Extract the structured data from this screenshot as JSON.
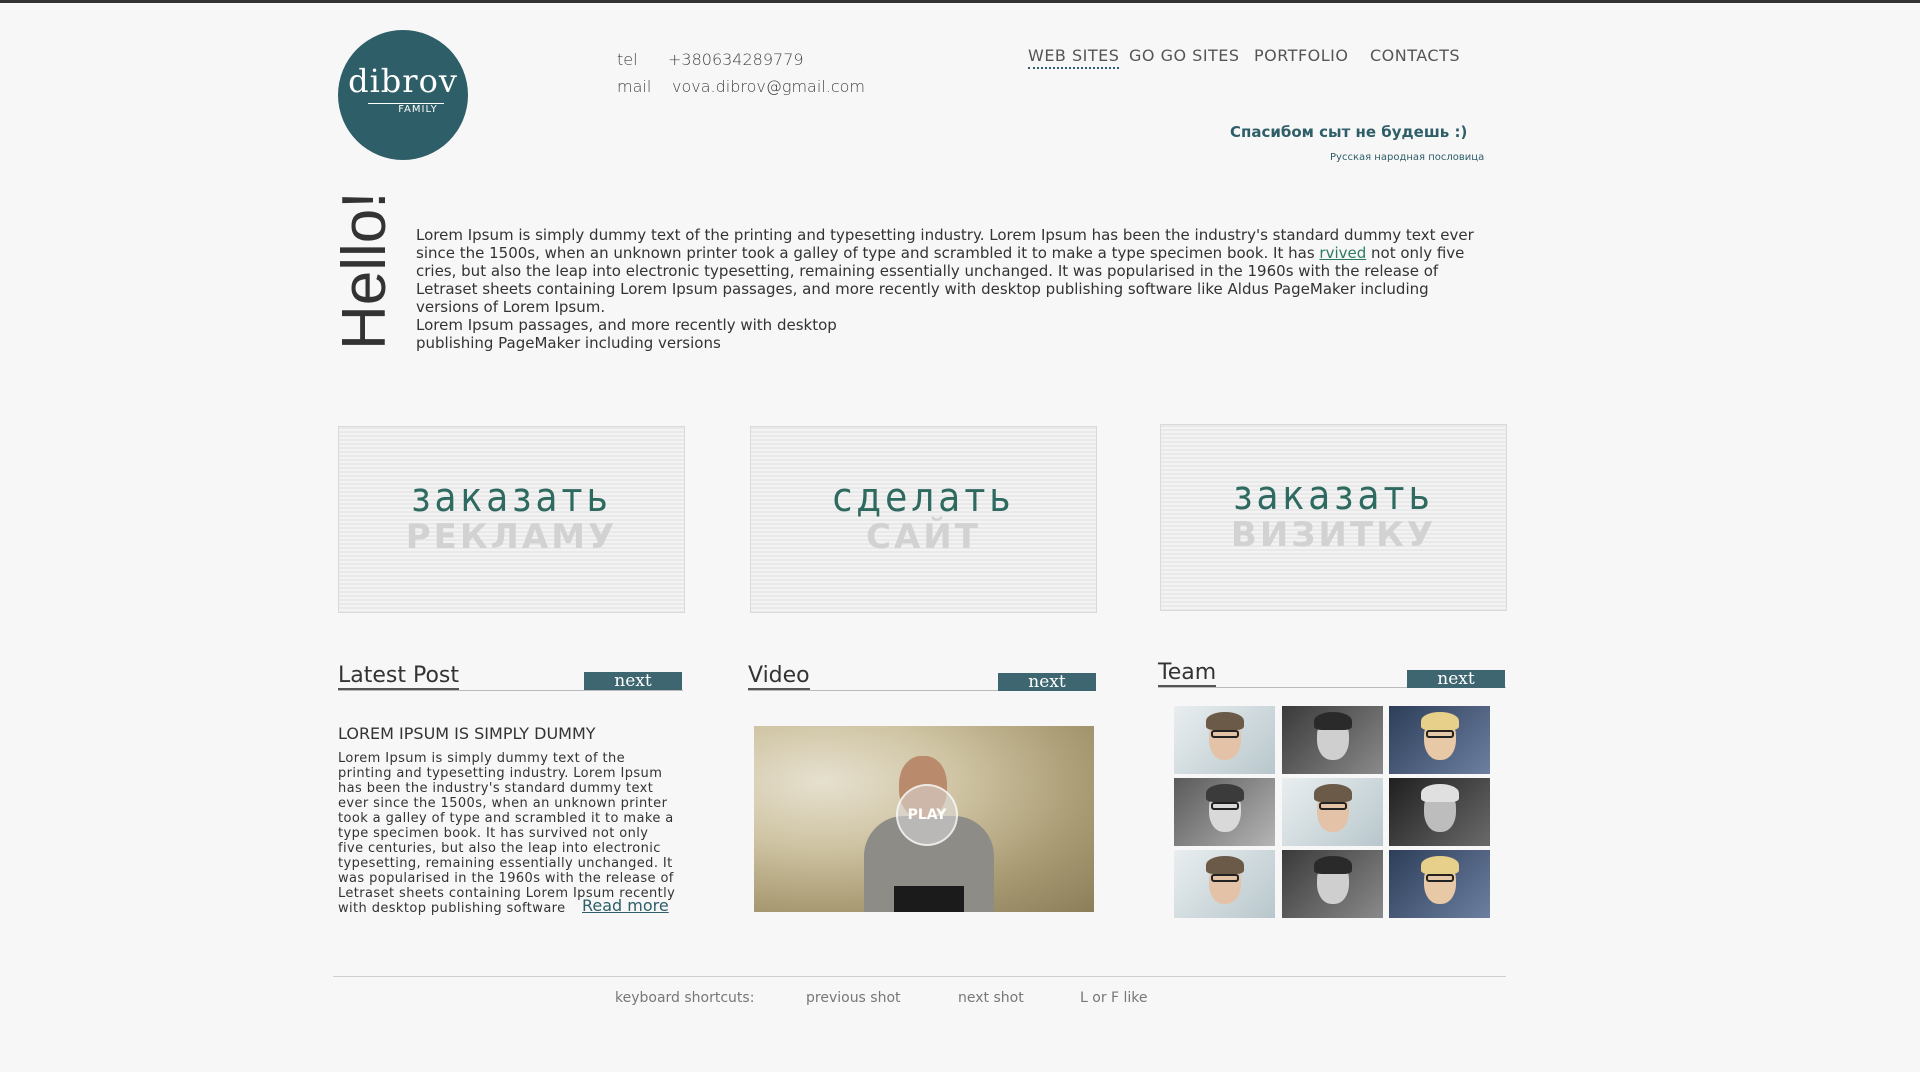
{
  "header": {
    "logo_main": "dibrov",
    "logo_sub": "FAMILY",
    "tel_label": "tel",
    "tel_value": "+380634289779",
    "mail_label": "mail",
    "mail_value": "vova.dibrov@gmail.com"
  },
  "nav": {
    "items": [
      {
        "label": "WEB SITES"
      },
      {
        "label": "GO GO SITES"
      },
      {
        "label": "PORTFOLIO"
      },
      {
        "label": "CONTACTS"
      }
    ]
  },
  "quote": {
    "text": "Спасибом сыт не будешь :)",
    "source": "Русская народная пословица"
  },
  "intro": {
    "hello": "Hello!",
    "para1_a": "Lorem Ipsum is simply dummy text of the printing and typesetting industry. Lorem Ipsum has been the industry's standard dummy text ever since the 1500s, when an unknown printer took a galley of type and scrambled it to make a type specimen book. It has ",
    "para1_link": "rvived",
    "para1_b": " not only five cries, but also the leap into electronic typesetting, remaining essentially unchanged. It was popularised in the 1960s with the release of Letraset sheets containing Lorem Ipsum passages, and more recently with desktop publishing software like Aldus PageMaker including versions of Lorem Ipsum.",
    "para2": "Lorem Ipsum passages, and more recently with desktop publishing PageMaker including versions"
  },
  "promos": [
    {
      "top": "заказать",
      "bottom": "РЕКЛАМУ"
    },
    {
      "top": "сделать",
      "bottom": "САЙТ"
    },
    {
      "top": "заказать",
      "bottom": "ВИЗИТКУ"
    }
  ],
  "sections": {
    "latest": {
      "title": "Latest Post",
      "next": "next"
    },
    "video": {
      "title": "Video",
      "next": "next",
      "play": "PLAY"
    },
    "team": {
      "title": "Team",
      "next": "next"
    }
  },
  "post": {
    "title": "LOREM IPSUM IS SIMPLY DUMMY",
    "body": "Lorem Ipsum is simply dummy text of the printing and typesetting industry. Lorem Ipsum has been the industry's standard dummy text ever since the 1500s, when an unknown printer took a galley of type and scrambled it to make a type specimen book. It has survived not only five centuries, but also the leap into electronic typesetting, remaining essentially unchanged. It was popularised in the 1960s with the release of Letraset sheets containing Lorem Ipsum recently with desktop publishing software",
    "read_more": "Read more"
  },
  "footer": {
    "shortcuts": "keyboard shortcuts:",
    "prev": "previous shot",
    "next": "next shot",
    "like": "L or F like"
  },
  "colors": {
    "accent": "#2e5e68",
    "green_text": "#2e6a60",
    "button": "#3d6670"
  }
}
